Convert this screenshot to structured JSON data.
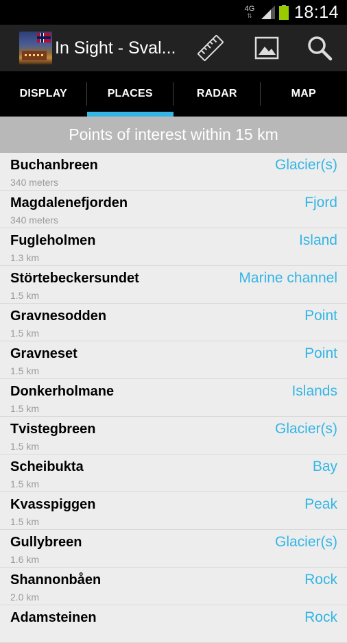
{
  "status_bar": {
    "network": "4G",
    "network_arrows": "⇅",
    "time": "18:14",
    "icons": [
      "signal-icon",
      "battery-icon"
    ]
  },
  "action_bar": {
    "title": "In Sight - Sval...",
    "icons": [
      "app-logo-icon",
      "ruler-icon",
      "image-icon",
      "search-icon"
    ]
  },
  "tabs": [
    {
      "label": "DISPLAY",
      "active": false
    },
    {
      "label": "PLACES",
      "active": true
    },
    {
      "label": "RADAR",
      "active": false
    },
    {
      "label": "MAP",
      "active": false
    }
  ],
  "section_header": "Points of interest within 15 km",
  "places": [
    {
      "name": "Buchanbreen",
      "distance": "340 meters",
      "type": "Glacier(s)"
    },
    {
      "name": "Magdalenefjorden",
      "distance": "340 meters",
      "type": "Fjord"
    },
    {
      "name": "Fugleholmen",
      "distance": "1.3 km",
      "type": "Island"
    },
    {
      "name": "Störtebeckersundet",
      "distance": "1.5 km",
      "type": "Marine channel"
    },
    {
      "name": "Gravnesodden",
      "distance": "1.5 km",
      "type": "Point"
    },
    {
      "name": "Gravneset",
      "distance": "1.5 km",
      "type": "Point"
    },
    {
      "name": "Donkerholmane",
      "distance": "1.5 km",
      "type": "Islands"
    },
    {
      "name": "Tvistegbreen",
      "distance": "1.5 km",
      "type": "Glacier(s)"
    },
    {
      "name": "Scheibukta",
      "distance": "1.5 km",
      "type": "Bay"
    },
    {
      "name": "Kvasspiggen",
      "distance": "1.5 km",
      "type": "Peak"
    },
    {
      "name": "Gullybreen",
      "distance": "1.6 km",
      "type": "Glacier(s)"
    },
    {
      "name": "Shannonbåen",
      "distance": "2.0 km",
      "type": "Rock"
    },
    {
      "name": "Adamsteinen",
      "distance": "",
      "type": "Rock"
    }
  ],
  "colors": {
    "accent": "#33b5e5",
    "background": "#ededed",
    "header": "#b8b8b8",
    "action_bar": "#222222"
  }
}
